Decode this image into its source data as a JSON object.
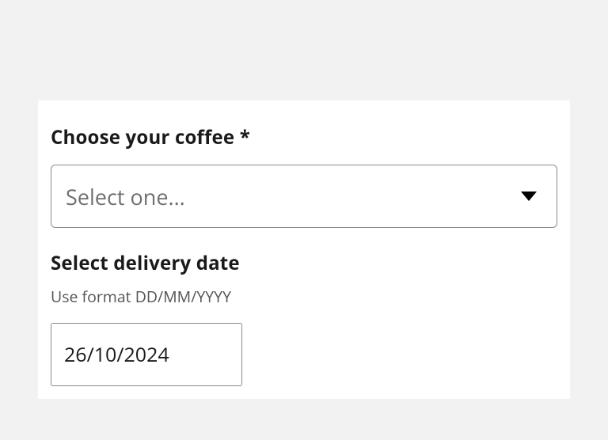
{
  "coffee": {
    "label": "Choose your coffee *",
    "placeholder": "Select one..."
  },
  "delivery": {
    "label": "Select delivery date",
    "hint": "Use format DD/MM/YYYY",
    "value": "26/10/2024"
  }
}
